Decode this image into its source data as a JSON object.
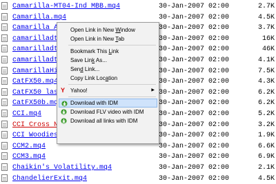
{
  "files": [
    {
      "name": "Camarilla-MT04-Ind MBB.mq4",
      "date": "30-Jan-2007 02:00",
      "size": "2.7K",
      "visited": false
    },
    {
      "name": "Camarilla.mq4",
      "date": "30-Jan-2007 02:00",
      "size": "4.5K",
      "visited": false
    },
    {
      "name": "Camarilla Ale",
      "date": "30-Jan-2007 02:00",
      "size": "3.7K",
      "visited": false
    },
    {
      "name": "camarilladt",
      "date": "30-Jan-2007 02:00",
      "size": "16K",
      "visited": false
    },
    {
      "name": "camarilladt",
      "date": "30-Jan-2007 02:00",
      "size": "46K",
      "visited": false
    },
    {
      "name": "camarilladt",
      "date": "30-Jan-2007 02:00",
      "size": "4.1K",
      "visited": false
    },
    {
      "name": "CamarillaHi",
      "date": "30-Jan-2007 02:00",
      "size": "7.5K",
      "visited": false
    },
    {
      "name": "CatFX50.mq4",
      "date": "30-Jan-2007 02:00",
      "size": "4.3K",
      "visited": false
    },
    {
      "name": "CatFX50 last",
      "date": "30-Jan-2007 02:00",
      "size": "6.2K",
      "visited": false
    },
    {
      "name": "CatFX50b.mq4",
      "date": "30-Jan-2007 02:00",
      "size": "6.2K",
      "visited": false
    },
    {
      "name": "CCI.mq4",
      "date": "30-Jan-2007 02:00",
      "size": "5.2K",
      "visited": false
    },
    {
      "name": "CCI Cross New.mq4",
      "date": "30-Jan-2007 02:00",
      "size": "3.2K",
      "visited": true
    },
    {
      "name": "CCI Woodies.mq4",
      "date": "30-Jan-2007 02:00",
      "size": "1.9K",
      "visited": false
    },
    {
      "name": "CCM2.mq4",
      "date": "30-Jan-2007 02:00",
      "size": "6.6K",
      "visited": false
    },
    {
      "name": "CCM3.mq4",
      "date": "30-Jan-2007 02:00",
      "size": "6.9K",
      "visited": false
    },
    {
      "name": "Chaikin's Volatility.mq4",
      "date": "30-Jan-2007 02:00",
      "size": "2.1K",
      "visited": false
    },
    {
      "name": "ChandelierExit.mq4",
      "date": "30-Jan-2007 02:00",
      "size": "4.5K",
      "visited": false
    }
  ],
  "context_menu": {
    "items": [
      {
        "id": "open-new-window",
        "pre": "Open Link in New ",
        "u": "W",
        "post": "indow",
        "icon": "",
        "submenu": false,
        "highlighted": false
      },
      {
        "id": "open-new-tab",
        "pre": "Open Link in New ",
        "u": "T",
        "post": "ab",
        "icon": "",
        "submenu": false,
        "highlighted": false
      },
      {
        "sep": true
      },
      {
        "id": "bookmark-link",
        "pre": "Bookmark This ",
        "u": "L",
        "post": "ink",
        "icon": "",
        "submenu": false,
        "highlighted": false
      },
      {
        "id": "save-link-as",
        "pre": "Save Lin",
        "u": "k",
        "post": " As...",
        "icon": "",
        "submenu": false,
        "highlighted": false
      },
      {
        "id": "send-link",
        "pre": "Sen",
        "u": "d",
        "post": " Link...",
        "icon": "",
        "submenu": false,
        "highlighted": false
      },
      {
        "id": "copy-link-location",
        "pre": "Copy Link Loc",
        "u": "a",
        "post": "tion",
        "icon": "",
        "submenu": false,
        "highlighted": false
      },
      {
        "sep": true
      },
      {
        "id": "yahoo",
        "pre": "Yahoo!",
        "u": "",
        "post": "",
        "icon": "yahoo-icon",
        "submenu": true,
        "highlighted": false
      },
      {
        "sep": true
      },
      {
        "id": "download-idm",
        "pre": "Download with IDM",
        "u": "",
        "post": "",
        "icon": "idm-icon",
        "submenu": false,
        "highlighted": true
      },
      {
        "id": "download-flv-idm",
        "pre": "Download FLV video with IDM",
        "u": "",
        "post": "",
        "icon": "idm-icon",
        "submenu": false,
        "highlighted": false
      },
      {
        "id": "download-all-idm",
        "pre": "Download all links with IDM",
        "u": "",
        "post": "",
        "icon": "idm-icon",
        "submenu": false,
        "highlighted": false
      }
    ]
  },
  "colors": {
    "link": "#0000ee",
    "visited": "#cc0000",
    "menu_bg": "#f2f2f2",
    "highlight": "#cfe3fb"
  }
}
